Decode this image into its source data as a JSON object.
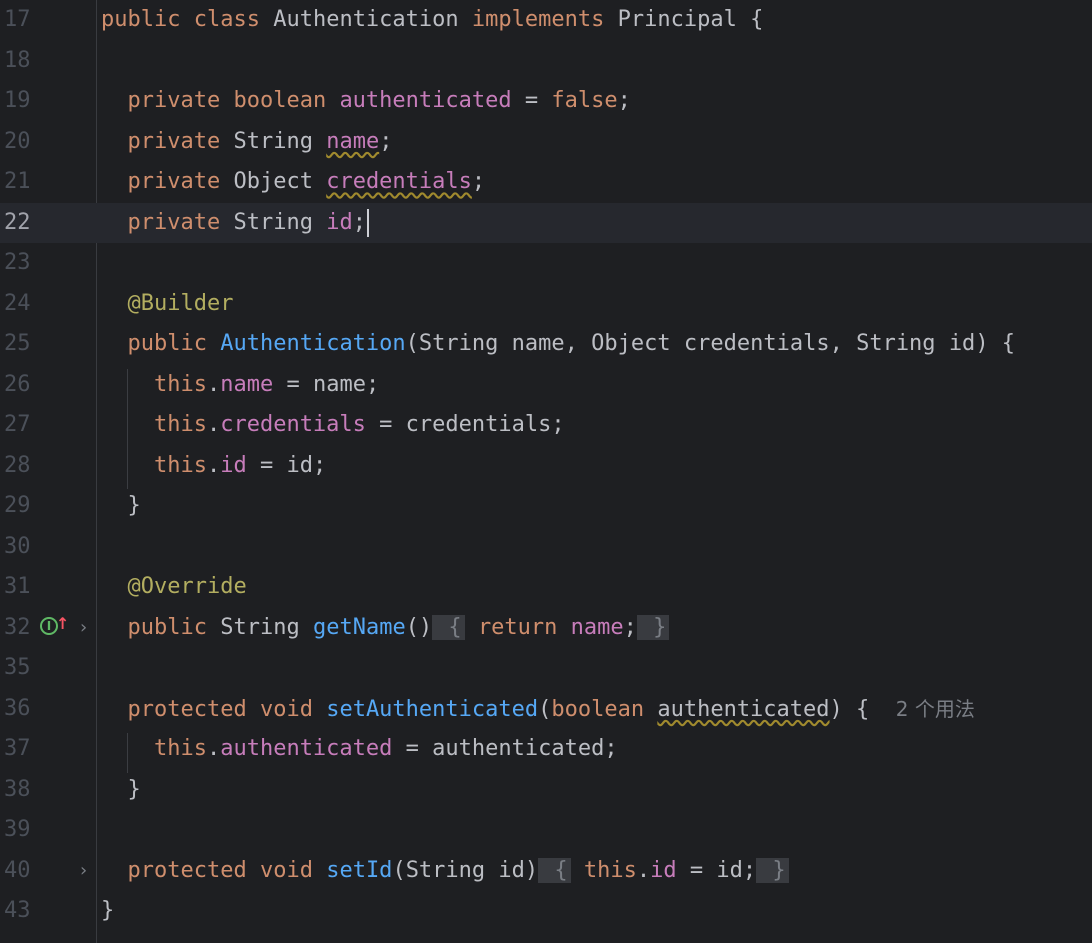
{
  "lines": [
    {
      "num": "17"
    },
    {
      "num": "18"
    },
    {
      "num": "19"
    },
    {
      "num": "20"
    },
    {
      "num": "21"
    },
    {
      "num": "22"
    },
    {
      "num": "23"
    },
    {
      "num": "24"
    },
    {
      "num": "25"
    },
    {
      "num": "26"
    },
    {
      "num": "27"
    },
    {
      "num": "28"
    },
    {
      "num": "29"
    },
    {
      "num": "30"
    },
    {
      "num": "31"
    },
    {
      "num": "32"
    },
    {
      "num": "35"
    },
    {
      "num": "36"
    },
    {
      "num": "37"
    },
    {
      "num": "38"
    },
    {
      "num": "39"
    },
    {
      "num": "40"
    },
    {
      "num": "43"
    }
  ],
  "code": {
    "kw_public": "public",
    "kw_class": "class",
    "kw_implements": "implements",
    "kw_private": "private",
    "kw_boolean": "boolean",
    "kw_false": "false",
    "kw_this": "this",
    "kw_return": "return",
    "kw_protected": "protected",
    "kw_void": "void",
    "class_name": "Authentication",
    "interface_name": "Principal",
    "type_string": "String",
    "type_object": "Object",
    "field_authenticated": "authenticated",
    "field_name": "name",
    "field_credentials": "credentials",
    "field_id": "id",
    "ann_builder": "@Builder",
    "ann_override": "@Override",
    "fn_getname": "getName",
    "fn_setauthenticated": "setAuthenticated",
    "fn_setid": "setId"
  },
  "inlay_hint_usages": "2 个用法",
  "gutter_icons": [
    "implementation-icon",
    "up-arrow-icon",
    "fold-chevron-icon"
  ]
}
